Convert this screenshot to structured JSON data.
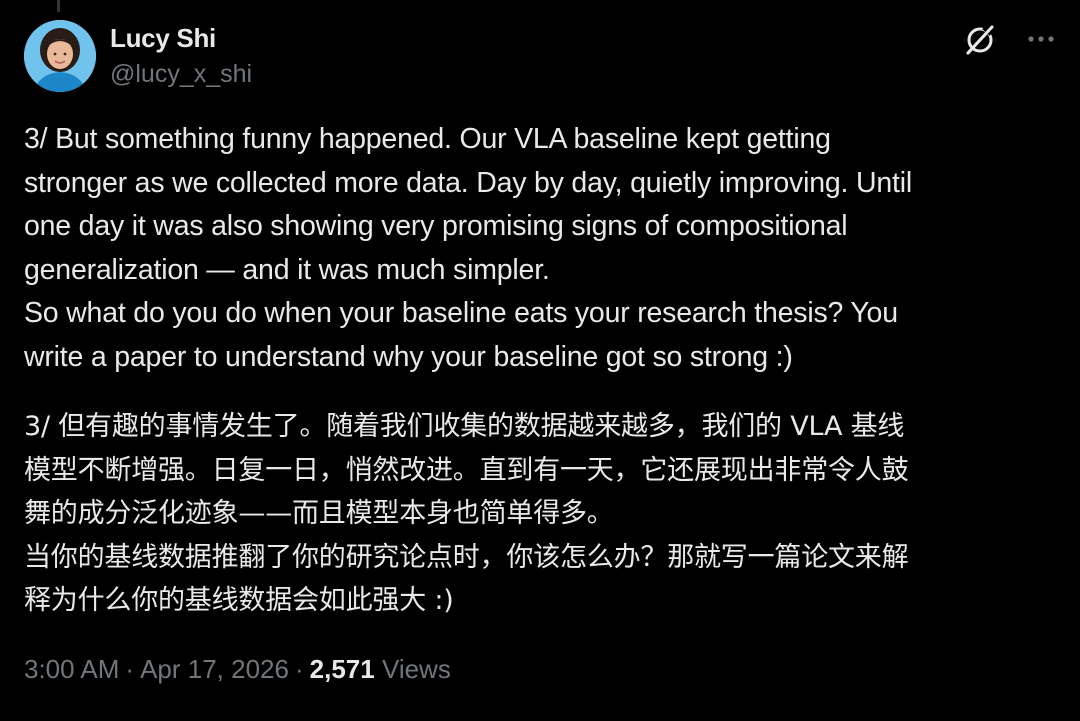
{
  "author": {
    "name": "Lucy Shi",
    "handle": "@lucy_x_shi"
  },
  "icons": {
    "grok": "grok-icon",
    "more": "more-icon",
    "avatar": "avatar"
  },
  "tweet": {
    "english_lines": [
      "3/ But something funny happened. Our VLA baseline kept getting",
      "stronger as we collected more data. Day by day, quietly improving. Until",
      "one day it was also showing very promising signs of compositional",
      "generalization — and it was much simpler.",
      "So what do you do when your baseline eats your research thesis? You",
      "write a paper to understand why your baseline got so strong :)"
    ],
    "chinese_lines": [
      "3/ 但有趣的事情发生了。随着我们收集的数据越来越多，我们的 VLA 基线",
      "模型不断增强。日复一日，悄然改进。直到有一天，它还展现出非常令人鼓",
      "舞的成分泛化迹象——而且模型本身也简单得多。",
      "当你的基线数据推翻了你的研究论点时，你该怎么办？那就写一篇论文来解",
      "释为什么你的基线数据会如此强大 :)"
    ]
  },
  "meta": {
    "time": "3:00 AM",
    "date": "Apr 17, 2026",
    "separator": "·",
    "view_count": "2,571",
    "views_label": "Views"
  },
  "colors": {
    "background": "#000000",
    "text": "#e7e9ea",
    "secondary": "#71767b"
  }
}
